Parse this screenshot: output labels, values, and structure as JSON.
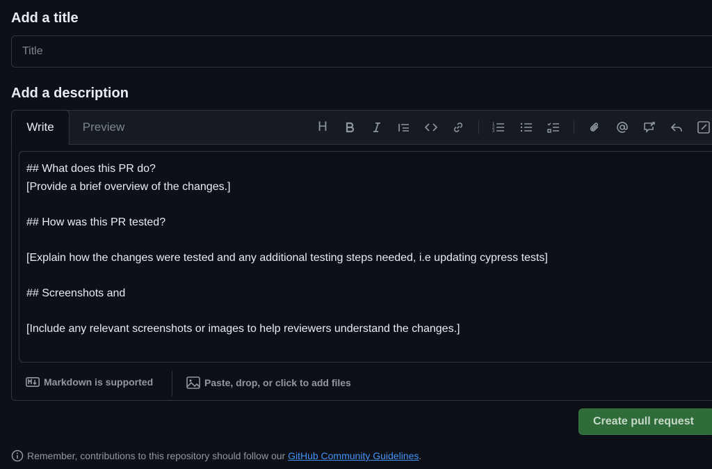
{
  "title_section": {
    "label": "Add a title",
    "placeholder": "Title"
  },
  "description_section": {
    "label": "Add a description",
    "tabs": [
      {
        "label": "Write",
        "active": true
      },
      {
        "label": "Preview",
        "active": false
      }
    ],
    "toolbar": {
      "heading_glyph": "H",
      "icons": [
        "bold-icon",
        "italic-icon",
        "quote-icon",
        "code-icon",
        "link-icon",
        "ordered-list-icon",
        "unordered-list-icon",
        "task-list-icon",
        "attach-icon",
        "mention-icon",
        "reference-icon",
        "reply-icon",
        "fullscreen-icon"
      ]
    },
    "body_text": "## What does this PR do?\n[Provide a brief overview of the changes.]\n\n## How was this PR tested?\n\n[Explain how the changes were tested and any additional testing steps needed, i.e updating cypress tests]\n\n## Screenshots and\n\n[Include any relevant screenshots or images to help reviewers understand the changes.]",
    "footer": {
      "markdown": "Markdown is supported",
      "files": "Paste, drop, or click to add files"
    }
  },
  "actions": {
    "create_label": "Create pull request"
  },
  "notice": {
    "text": "Remember, contributions to this repository should follow our ",
    "link": "GitHub Community Guidelines",
    "suffix": "."
  },
  "colors": {
    "background": "#0d1117",
    "border": "#30363d",
    "primary_button": "#2f6c3a",
    "link": "#4493f8"
  }
}
